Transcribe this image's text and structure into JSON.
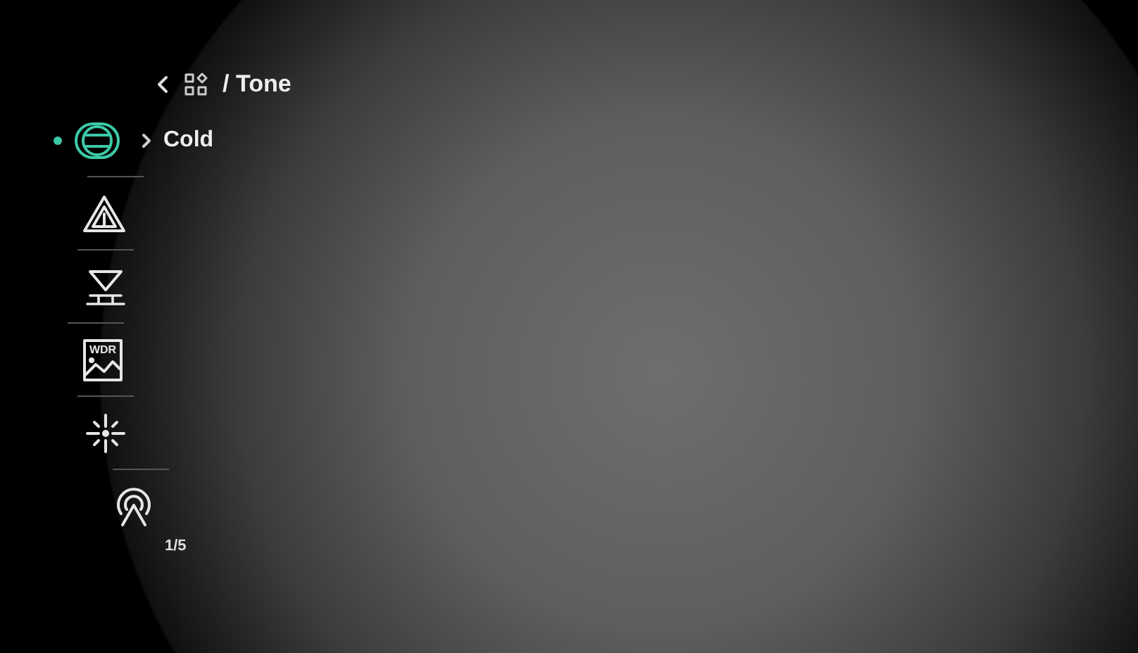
{
  "breadcrumb": {
    "title": "/ Tone"
  },
  "menu": [
    {
      "kind": "palette",
      "selected": true,
      "value": "Cold"
    },
    {
      "kind": "alert",
      "selected": false
    },
    {
      "kind": "calibration",
      "selected": false
    },
    {
      "kind": "wdr",
      "selected": false,
      "icon_text": "WDR"
    },
    {
      "kind": "sparkle",
      "selected": false
    },
    {
      "kind": "hotspot",
      "selected": false
    }
  ],
  "page_indicator": "1/5"
}
